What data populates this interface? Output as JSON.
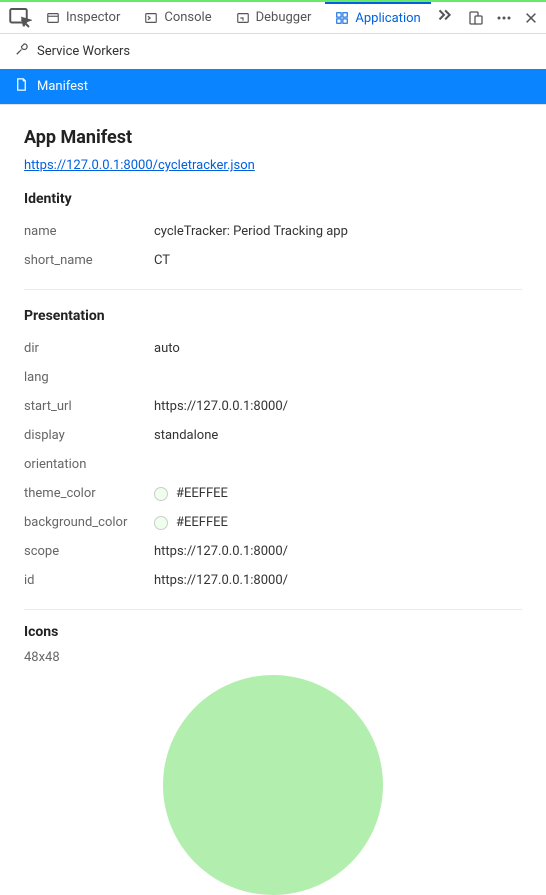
{
  "tabs": {
    "inspector": "Inspector",
    "console": "Console",
    "debugger": "Debugger",
    "application": "Application"
  },
  "sidebar": {
    "service_workers": "Service Workers",
    "manifest": "Manifest"
  },
  "manifest": {
    "title": "App Manifest",
    "url": "https://127.0.0.1:8000/cycletracker.json",
    "identity": {
      "heading": "Identity",
      "name_label": "name",
      "name_value": "cycleTracker: Period Tracking app",
      "short_name_label": "short_name",
      "short_name_value": "CT"
    },
    "presentation": {
      "heading": "Presentation",
      "dir_label": "dir",
      "dir_value": "auto",
      "lang_label": "lang",
      "lang_value": "",
      "start_url_label": "start_url",
      "start_url_value": "https://127.0.0.1:8000/",
      "display_label": "display",
      "display_value": "standalone",
      "orientation_label": "orientation",
      "orientation_value": "",
      "theme_color_label": "theme_color",
      "theme_color_value": "#EEFFEE",
      "theme_color_swatch": "#EEFFEE",
      "background_color_label": "background_color",
      "background_color_value": "#EEFFEE",
      "background_color_swatch": "#EEFFEE",
      "scope_label": "scope",
      "scope_value": "https://127.0.0.1:8000/",
      "id_label": "id",
      "id_value": "https://127.0.0.1:8000/"
    },
    "icons": {
      "heading": "Icons",
      "size": "48x48",
      "preview_color": "#B2EEAE"
    }
  },
  "colors": {
    "active_tab": "#0060df",
    "selected_row": "#0a84ff"
  }
}
